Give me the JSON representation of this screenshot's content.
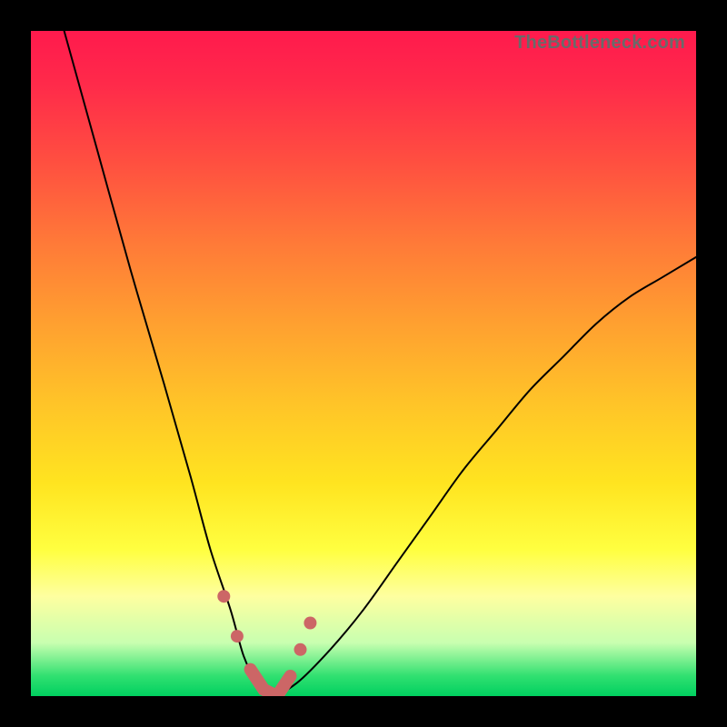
{
  "watermark": "TheBottleneck.com",
  "chart_data": {
    "type": "line",
    "title": "",
    "xlabel": "",
    "ylabel": "",
    "xlim": [
      0,
      100
    ],
    "ylim": [
      0,
      100
    ],
    "series": [
      {
        "name": "bottleneck-curve",
        "x": [
          5,
          10,
          15,
          20,
          24,
          27,
          30,
          32,
          34,
          36,
          40,
          45,
          50,
          55,
          60,
          65,
          70,
          75,
          80,
          85,
          90,
          95,
          100
        ],
        "values": [
          100,
          82,
          64,
          47,
          33,
          22,
          13,
          6,
          2,
          0,
          2,
          7,
          13,
          20,
          27,
          34,
          40,
          46,
          51,
          56,
          60,
          63,
          66
        ]
      }
    ],
    "markers": {
      "name": "highlighted-points",
      "x": [
        29,
        31,
        33,
        35,
        37,
        39,
        40.5,
        42
      ],
      "values": [
        15,
        9,
        4,
        1,
        0,
        3,
        7,
        11
      ]
    }
  },
  "colors": {
    "curve": "#000000",
    "marker": "#cc6666",
    "gradient_top": "#ff1a4d",
    "gradient_bottom": "#00d060"
  }
}
